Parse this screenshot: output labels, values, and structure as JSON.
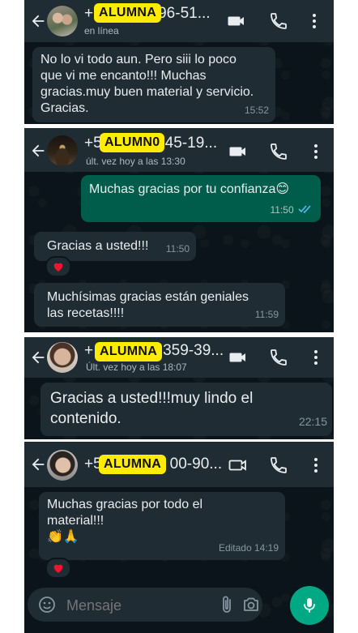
{
  "chats": [
    {
      "name_prefix": "+",
      "name_suffix": "96-51...",
      "badge": "ALUMNA",
      "status": "en línea",
      "messages": [
        {
          "text": "No lo vi todo aun. Pero siii lo poco\nque vi me encanto!!! Muchas\ngracias.muy buen material y servicio.\nGracias.",
          "time": "15:52",
          "direction": "in"
        }
      ]
    },
    {
      "name_prefix": "+5",
      "name_suffix": "45-19...",
      "badge": "ALUMN0",
      "status": "últ. vez hoy a las 13:30",
      "messages": [
        {
          "text": "Muchas gracias por tu confianza😊",
          "time": "11:50",
          "direction": "out",
          "read": true
        },
        {
          "text": "Gracias a usted!!!",
          "time": "11:50",
          "direction": "in",
          "reaction": "❤️"
        },
        {
          "text": "Muchísimas gracias están geniales\nlas recetas!!!!",
          "time": "11:59",
          "direction": "in"
        }
      ]
    },
    {
      "name_prefix": "+",
      "name_suffix": "359-39...",
      "badge": "ALUMNA",
      "status": "Últ. vez hoy a las 18:07",
      "messages": [
        {
          "text": "Gracias a usted!!!muy lindo el\ncontenido.",
          "time": "22:15",
          "direction": "in"
        }
      ]
    },
    {
      "name_prefix": "+5",
      "name_suffix": "00-90...",
      "badge": "ALUMNA",
      "status": "",
      "messages": [
        {
          "text": "Muchas gracias por todo el\nmaterial!!!\n👏🙏",
          "time": "Editado 14:19",
          "direction": "in",
          "reaction": "❤️"
        }
      ],
      "input": {
        "placeholder": "Mensaje"
      }
    }
  ],
  "icons": {
    "back": "arrow-left-icon",
    "video": "video-call-icon",
    "call": "phone-icon",
    "menu": "more-vert-icon",
    "emoji": "sticker-icon",
    "attach": "paperclip-icon",
    "camera": "camera-icon",
    "mic": "microphone-icon"
  },
  "colors": {
    "header": "#1f2c34",
    "chat_bg": "#0b141a",
    "incoming": "#1f2c34",
    "outgoing": "#005c4b",
    "accent": "#00a884",
    "badge": "#ffec00",
    "read_ticks": "#53bdeb"
  }
}
